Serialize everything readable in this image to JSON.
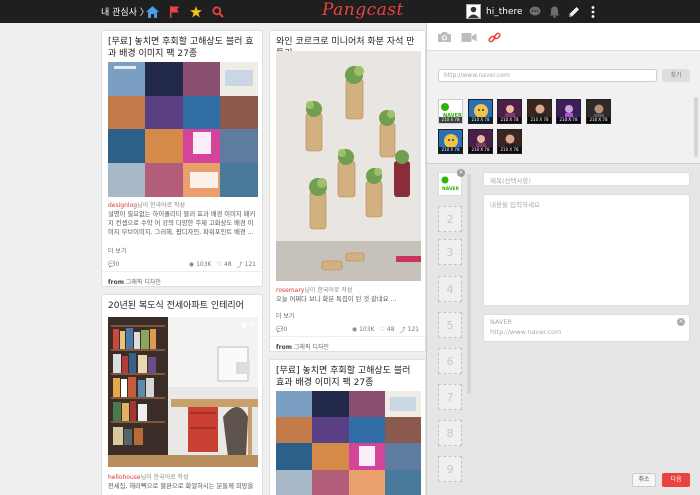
{
  "topbar": {
    "my_interest": "내 관심사 〉",
    "logo": "Pangcast",
    "username": "hi_there"
  },
  "feed": {
    "card1": {
      "title": "[무료] 놓치면 후회할 고해상도 블러 효과 배경 이미지 팩 27종",
      "source_user": "designlog",
      "source_suffix": "님이 한국어로 작성",
      "desc": "설명이 필요없는 하이퀄리티 블러 효과 배경 이미지 패키지 컨셉으로 수학 어 강의 다양한 주제 고화상도 배경 이미지 무브이미지. 그러해, 팝디자인, 파워포인트 배경 ...",
      "more": "더 보기",
      "comments": "0",
      "views": "103K",
      "likes": "48",
      "shares": "121",
      "from_label": "from",
      "from_value": "그래픽 디자인"
    },
    "card2": {
      "title": "와인 코르크로 미니어처 화분 자석 만들기",
      "source_user": "rosemary",
      "source_suffix": "님이 한국어로 작성",
      "desc": "오늘 어쩌다 보니 화분 특집이 된 것 같네요 ...",
      "more": "더 보기",
      "comments": "0",
      "views": "103K",
      "likes": "48",
      "shares": "121",
      "from_label": "from",
      "from_value": "그래픽 디자인"
    },
    "card3": {
      "title": "20년된 복도식 전세아파트 인테리어",
      "image_count": "4",
      "source_user": "hellohouse",
      "source_suffix": "님이 한국어로 작성",
      "desc": "전세집, 해라뼉으로 불완으로 화얼하시는 분들께 희망을"
    },
    "card4": {
      "title": "[무료] 놓치면 후회할 고해상도 블러 효과 배경 이미지 팩 27종"
    }
  },
  "panel": {
    "url_placeholder": "http://www.naver.com",
    "url_button": "찾기",
    "thumb_caption": "210 X 78",
    "title_placeholder": "제목(선택사항)",
    "content_placeholder": "내용을 입력하세요",
    "link_name": "NAVER",
    "link_url": "http://www.naver.com",
    "slots": [
      "2",
      "3",
      "4",
      "5",
      "6",
      "7",
      "8",
      "9"
    ],
    "cancel": "취소",
    "next": "다음"
  },
  "colors": {
    "accent": "#e8433f",
    "topbar": "#1f1f1f"
  }
}
